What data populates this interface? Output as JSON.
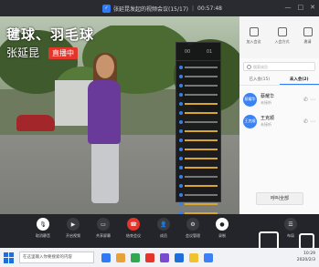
{
  "window": {
    "title": "张延昆发起的视频会议(15/17)",
    "timer": "00:57:48",
    "controls": [
      "minimize",
      "maximize",
      "close"
    ]
  },
  "video": {
    "overlay_title": "毽球、羽毛球",
    "presenter_name": "张延昆",
    "live_badge": "直播中"
  },
  "chat_panel": {
    "header_items": [
      "00",
      "01"
    ]
  },
  "side_panel": {
    "top_buttons": [
      {
        "label": "加入会议",
        "icon": "join-icon"
      },
      {
        "label": "入会方式",
        "icon": "share-icon"
      },
      {
        "label": "邀请",
        "icon": "invite-icon"
      }
    ],
    "search_placeholder": "搜索成员",
    "tabs": [
      "已入会(15)",
      "未入会(2)"
    ],
    "active_tab": 1,
    "members": [
      {
        "avatar": "蔡耀华",
        "name": "蔡耀华",
        "status": "未接听"
      },
      {
        "avatar": "王克顺",
        "name": "王克顺",
        "status": "未接听"
      }
    ],
    "call_all_label": "呼叫全部"
  },
  "toolbar": {
    "items": [
      {
        "label": "取消静音",
        "icon": "mic-icon"
      },
      {
        "label": "开启视频",
        "icon": "camera-icon"
      },
      {
        "label": "共享屏幕",
        "icon": "screen-share-icon"
      },
      {
        "label": "结束会议",
        "icon": "end-call-icon"
      },
      {
        "label": "成员",
        "icon": "members-icon"
      },
      {
        "label": "会议管理",
        "icon": "manage-icon"
      },
      {
        "label": "录制",
        "icon": "record-icon"
      },
      {
        "label": "布局",
        "icon": "layout-icon"
      }
    ]
  },
  "taskbar": {
    "search_placeholder": "在这里输入你要搜索的内容",
    "time": "10:29",
    "date": "2020/2/3",
    "app_colors": [
      "#2f7bf5",
      "#e8a13a",
      "#33a852",
      "#e5352b",
      "#7a4bd1",
      "#1e6fd9",
      "#f2c12e",
      "#3b82f6"
    ]
  }
}
